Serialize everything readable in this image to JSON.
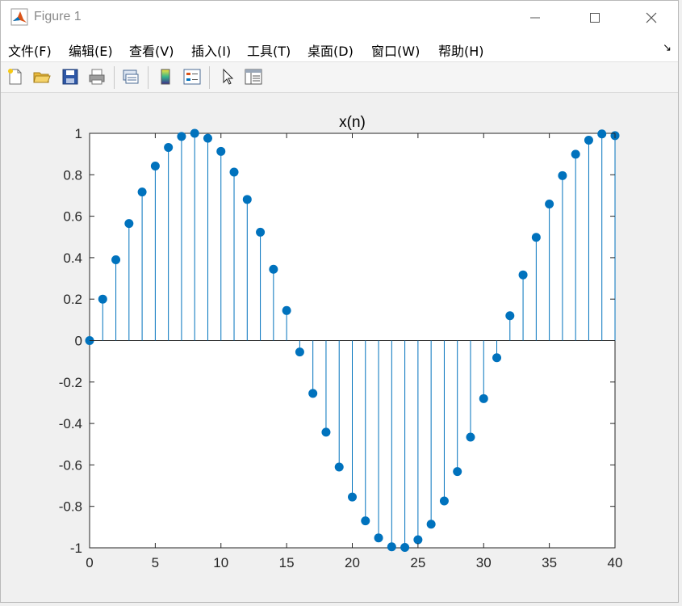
{
  "window": {
    "title": "Figure 1",
    "controls": {
      "minimize": "—",
      "maximize": "☐",
      "close": "✕"
    }
  },
  "menu": {
    "items": [
      "文件(F)",
      "编辑(E)",
      "查看(V)",
      "插入(I)",
      "工具(T)",
      "桌面(D)",
      "窗口(W)",
      "帮助(H)"
    ],
    "dock_arrow": "↘"
  },
  "toolbar": {
    "buttons": [
      "new-figure-icon",
      "open-folder-icon",
      "save-icon",
      "print-icon",
      "link-figure-icon",
      "colorbar-icon",
      "legend-icon",
      "pointer-icon",
      "property-inspector-icon"
    ]
  },
  "colors": {
    "stem": "#0072bd",
    "axes_background": "#ffffff",
    "figure_background": "#f0f0f0"
  },
  "chart_data": {
    "type": "stem",
    "title": "x(n)",
    "xlabel": "",
    "ylabel": "",
    "xlim": [
      0,
      40
    ],
    "ylim": [
      -1,
      1
    ],
    "xticks": [
      "0",
      "5",
      "10",
      "15",
      "20",
      "25",
      "30",
      "35",
      "40"
    ],
    "yticks": [
      "1",
      "0.8",
      "0.6",
      "0.4",
      "0.2",
      "0",
      "-0.2",
      "-0.4",
      "-0.6",
      "-0.8",
      "-1"
    ],
    "grid": false,
    "x": [
      0,
      1,
      2,
      3,
      4,
      5,
      6,
      7,
      8,
      9,
      10,
      11,
      12,
      13,
      14,
      15,
      16,
      17,
      18,
      19,
      20,
      21,
      22,
      23,
      24,
      25,
      26,
      27,
      28,
      29,
      30,
      31,
      32,
      33,
      34,
      35,
      36,
      37,
      38,
      39,
      40
    ],
    "y": [
      0,
      0.2,
      0.39,
      0.565,
      0.717,
      0.842,
      0.932,
      0.985,
      1.0,
      0.976,
      0.913,
      0.813,
      0.681,
      0.523,
      0.344,
      0.145,
      -0.055,
      -0.255,
      -0.442,
      -0.61,
      -0.755,
      -0.87,
      -0.952,
      -0.995,
      -0.998,
      -0.961,
      -0.886,
      -0.774,
      -0.632,
      -0.466,
      -0.28,
      -0.083,
      0.12,
      0.317,
      0.498,
      0.659,
      0.796,
      0.899,
      0.967,
      0.997,
      0.989
    ]
  }
}
